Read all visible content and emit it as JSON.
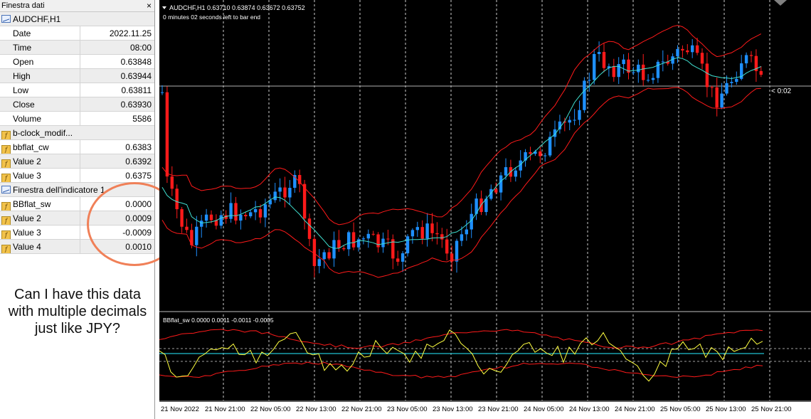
{
  "data_window": {
    "title": "Finestra dati",
    "symbol_header": "AUDCHF,H1",
    "rows": [
      {
        "label": "Date",
        "value": "2022.11.25"
      },
      {
        "label": "Time",
        "value": "08:00"
      },
      {
        "label": "Open",
        "value": "0.63848"
      },
      {
        "label": "High",
        "value": "0.63944"
      },
      {
        "label": "Low",
        "value": "0.63811"
      },
      {
        "label": "Close",
        "value": "0.63930"
      },
      {
        "label": "Volume",
        "value": "5586"
      }
    ],
    "indicator1_header": "b-clock_modif...",
    "indicator1_rows": [
      {
        "label": "bbflat_cw",
        "value": "0.6383"
      },
      {
        "label": "Value 2",
        "value": "0.6392"
      },
      {
        "label": "Value 3",
        "value": "0.6375"
      }
    ],
    "indicator_window_header": "Finestra dell'indicatore 1",
    "indicator2_rows": [
      {
        "label": "BBflat_sw",
        "value": "0.0000"
      },
      {
        "label": "Value 2",
        "value": "0.0009"
      },
      {
        "label": "Value 3",
        "value": "-0.0009"
      },
      {
        "label": "Value 4",
        "value": "0.0010"
      }
    ]
  },
  "annotation": {
    "question": "Can I have this data with multiple decimals just like JPY?",
    "circle_color": "#f08058"
  },
  "main_chart": {
    "header": "AUDCHF,H1  0.63710 0.63874 0.63672 0.63752",
    "subheader": "0 minutes 02 seconds left to bar end",
    "price_label": "< 0:02"
  },
  "sub_chart": {
    "header": "BBflat_sw 0.0000 0.0011 -0.0011 -0.0005"
  },
  "time_axis": [
    "21 Nov 2022",
    "21 Nov 21:00",
    "22 Nov 05:00",
    "22 Nov 13:00",
    "22 Nov 21:00",
    "23 Nov 05:00",
    "23 Nov 13:00",
    "23 Nov 21:00",
    "24 Nov 05:00",
    "24 Nov 13:00",
    "24 Nov 21:00",
    "25 Nov 05:00",
    "25 Nov 13:00",
    "25 Nov 21:00"
  ],
  "colors": {
    "bull_candle": "#1e90ff",
    "bear_candle": "#ff1a1a",
    "bands": "#ff1a1a",
    "middle_line": "#40e0d0",
    "oscillator": "#ffff40",
    "level_line": "#20c0d0"
  }
}
